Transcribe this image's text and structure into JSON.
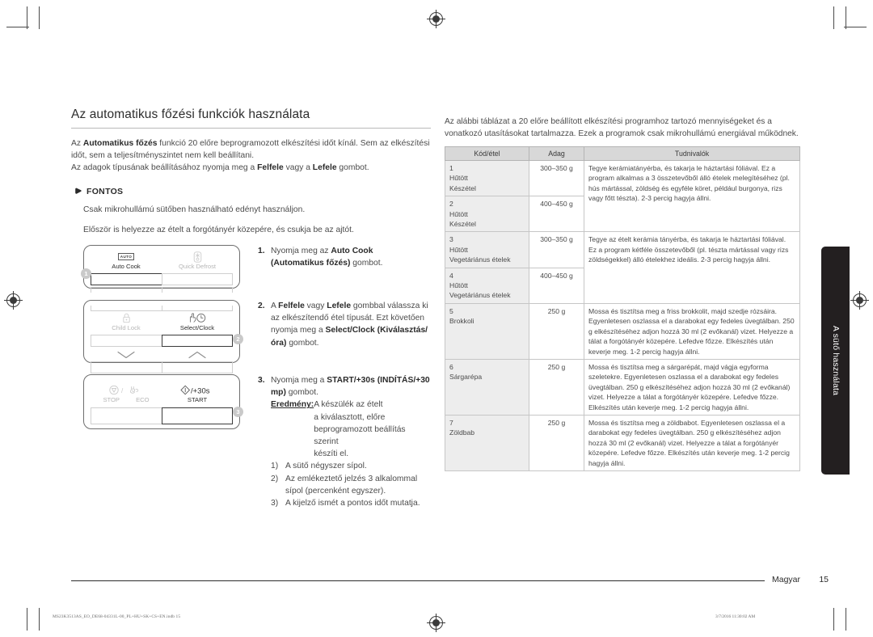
{
  "document": {
    "title": "Az automatikus főzési funkciók használata",
    "intro_paragraphs": [
      "Az Automatikus főzés funkció 20 előre beprogramozott elkészítési időt kínál. Sem az elkészítési időt, sem a teljesítményszintet nem kell beállítani.",
      "Az adagok típusának beállításához nyomja meg a Felfele vagy a Lefele gombot."
    ],
    "important_label": "FONTOS",
    "important_text": "Csak mikrohullámú sütőben használható edényt használjon.",
    "preamble": "Először is helyezze az ételt a forgótányér közepére, és csukja be az ajtót."
  },
  "steps": [
    {
      "num": "1.",
      "text_plain": "Nyomja meg az Auto Cook (Automatikus főzés) gombot.",
      "line1_pre": "Nyomja meg az ",
      "line1_bold": "Auto Cook",
      "line2_bold": "(Automatikus főzés)",
      "line2_post": " gombot."
    },
    {
      "num": "2.",
      "p1": "A ",
      "b1": "Felfele",
      "p2": " vagy ",
      "b2": "Lefele",
      "p3": " gombbal válassza ki az elkészítendő étel típusát. Ezt követően nyomja meg a ",
      "b3": "Select/Clock (Kiválasztás/óra)",
      "p4": " gombot."
    },
    {
      "num": "3.",
      "p1": "Nyomja meg a ",
      "b1": "START/+30s (INDÍTÁS/+30 mp)",
      "p2": " gombot.",
      "result_label": "Eredmény:",
      "result_text": "A készülék az ételt a kiválasztott, előre beprogramozott beállítás szerint készíti el.",
      "sub_items": [
        {
          "num": "1)",
          "text": "A sütő négyszer sípol."
        },
        {
          "num": "2)",
          "text": "Az emlékeztető jelzés 3 alkalommal sípol (percenként egyszer)."
        },
        {
          "num": "3)",
          "text": "A kijelző ismét a pontos időt mutatja."
        }
      ]
    }
  ],
  "control_panels": [
    {
      "id": "panel-auto-cook",
      "marker": "1",
      "keys": [
        {
          "label": "Auto Cook",
          "icon": "auto-chip-icon",
          "state": "active"
        },
        {
          "label": "Quick Defrost",
          "icon": "snowflake-icon",
          "state": "dim"
        }
      ]
    },
    {
      "id": "panel-select-clock",
      "marker": "2",
      "keys": [
        {
          "label": "Child Lock",
          "icon": "lock-icon",
          "state": "dim"
        },
        {
          "label": "Select/Clock",
          "icon": "hand-clock-icon",
          "state": "active"
        }
      ],
      "arrows": [
        "chevron-down-icon",
        "chevron-up-icon"
      ]
    },
    {
      "id": "panel-start",
      "marker": "3",
      "keys": [
        {
          "label": "STOP / ECO",
          "icon": "stop-eco-icon",
          "state": "dim"
        },
        {
          "label": "START",
          "suffix": "/+30s",
          "icon": "start-icon",
          "state": "active"
        }
      ]
    }
  ],
  "right_column": {
    "intro": "Az alábbi táblázat a 20 előre beállított elkészítési programhoz tartozó mennyiségeket és a vonatkozó utasításokat tartalmazza. Ezek a programok csak mikrohullámú energiával működnek."
  },
  "table": {
    "headers": [
      "Kód/étel",
      "Adag",
      "Tudnivalók"
    ],
    "rows": [
      {
        "code_lines": [
          "1",
          "Hűtött",
          "Készétel"
        ],
        "amount": "300–350 g",
        "note": "Tegye kerámiatányérba, és takarja le háztartási fóliával. Ez a program alkalmas a 3 összetevőből álló ételek melegítéséhez (pl. hús mártással, zöldség és egyféle köret, például burgonya, rizs vagy főtt tészta). 2-3 percig hagyja állni.",
        "note_rowspan": 2
      },
      {
        "code_lines": [
          "2",
          "Hűtött",
          "Készétel"
        ],
        "amount": "400–450 g",
        "note": null
      },
      {
        "code_lines": [
          "3",
          "Hűtött",
          "Vegetáriánus ételek"
        ],
        "amount": "300–350 g",
        "note": "Tegye az ételt kerámia tányérba, és takarja le háztartási fóliával. Ez a program kétféle összetevőből (pl. tészta mártással vagy rizs zöldségekkel) álló ételekhez ideális. 2-3 percig hagyja állni.",
        "note_rowspan": 2
      },
      {
        "code_lines": [
          "4",
          "Hűtött",
          "Vegetáriánus ételek"
        ],
        "amount": "400–450 g",
        "note": null
      },
      {
        "code_lines": [
          "5",
          "Brokkoli"
        ],
        "amount": "250 g",
        "note": "Mossa és tisztítsa meg a friss brokkolit, majd szedje rózsáira. Egyenletesen oszlassa el a darabokat egy fedeles üvegtálban. 250 g elkészítéséhez adjon hozzá 30 ml (2 evőkanál) vizet. Helyezze a tálat a forgótányér közepére. Lefedve főzze. Elkészítés után keverje meg. 1-2 percig hagyja állni.",
        "note_rowspan": 1
      },
      {
        "code_lines": [
          "6",
          "Sárgarépa"
        ],
        "amount": "250 g",
        "note": "Mossa és tisztítsa meg a sárgarépát, majd vágja egyforma szeletekre. Egyenletesen oszlassa el a darabokat egy fedeles üvegtálban. 250 g elkészítéséhez adjon hozzá 30 ml (2 evőkanál) vizet. Helyezze a tálat a forgótányér közepére. Lefedve főzze. Elkészítés után keverje meg. 1-2 percig hagyja állni.",
        "note_rowspan": 1
      },
      {
        "code_lines": [
          "7",
          "Zöldbab"
        ],
        "amount": "250 g",
        "note": "Mossa és tisztítsa meg a zöldbabot. Egyenletesen oszlassa el a darabokat egy fedeles üvegtálban. 250 g elkészítéséhez adjon hozzá 30 ml (2 evőkanál) vizet. Helyezze a tálat a forgótányér közepére. Lefedve főzze. Elkészítés után keverje meg. 1-2 percig hagyja állni.",
        "note_rowspan": 1
      }
    ]
  },
  "side_tab": {
    "label": "A sütő használata"
  },
  "footer": {
    "language": "Magyar",
    "page_number": "15",
    "print_code": "MS23K3513AS_EO_DE68-04331L-00_PL+HU+SK+CS+EN.indb   15",
    "print_time": "3/7/2016   11:30:02 AM"
  }
}
